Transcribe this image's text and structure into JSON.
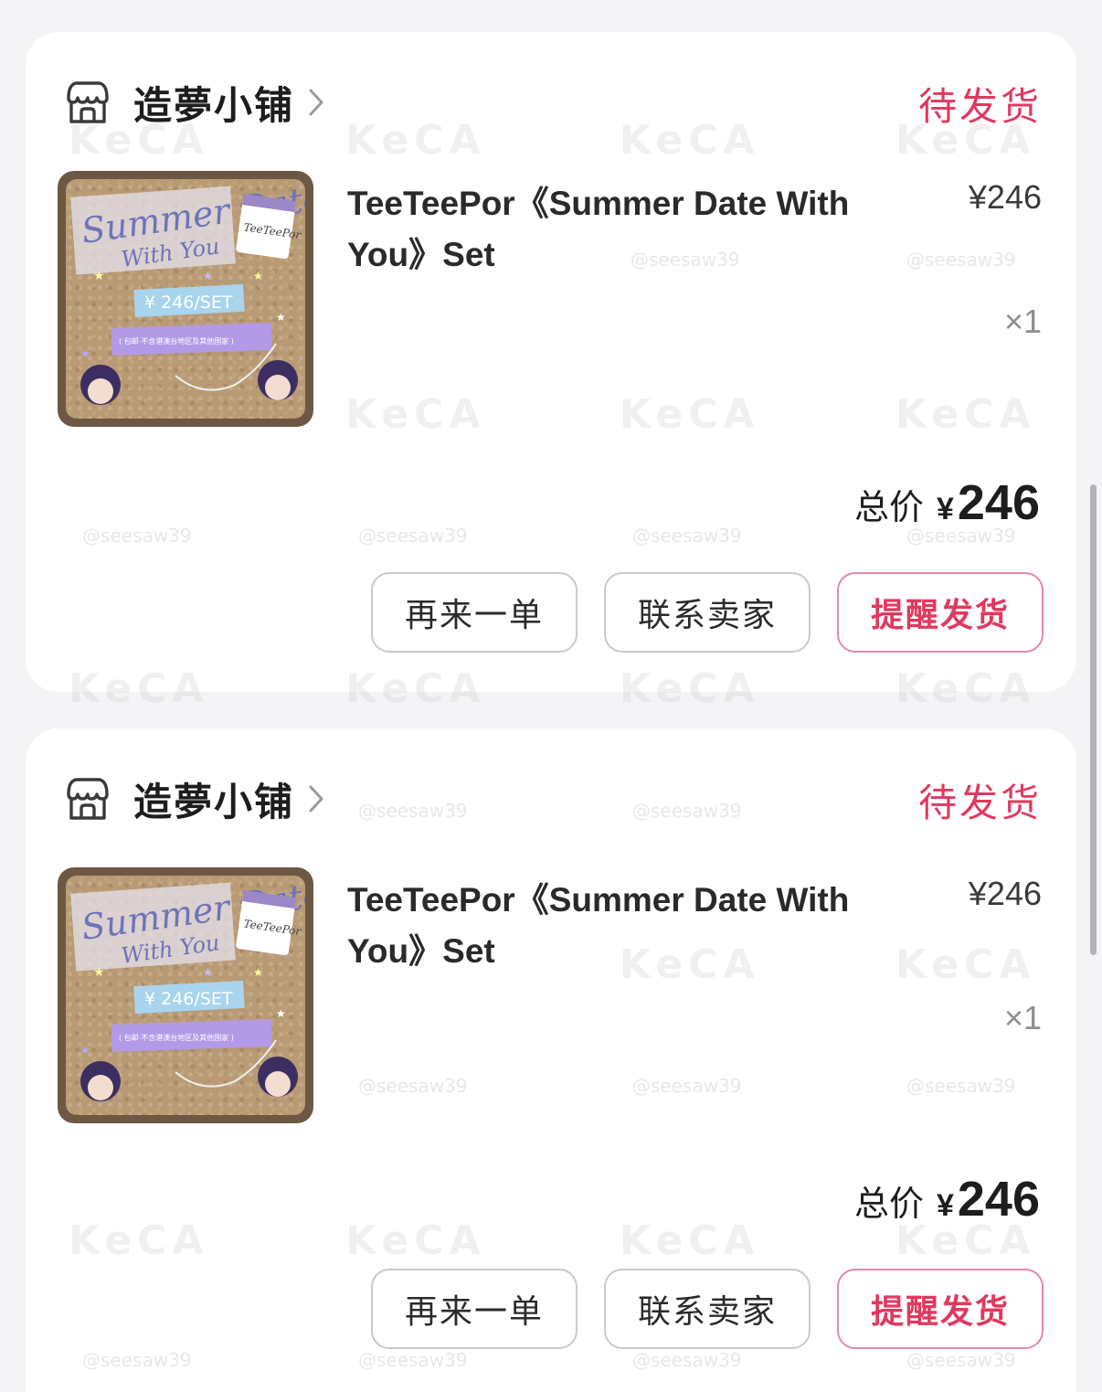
{
  "orders": [
    {
      "shop_name": "造夢小铺",
      "status": "待发货",
      "product_title": "TeeTeePor《Summer Date With You》Set",
      "unit_price": "¥246",
      "quantity": "×1",
      "total_label": "总价",
      "total_currency": "¥",
      "total_amount": "246",
      "actions": [
        "再来一单",
        "联系卖家",
        "提醒发货"
      ]
    },
    {
      "shop_name": "造夢小铺",
      "status": "待发货",
      "product_title": "TeeTeePor《Summer Date With You》Set",
      "unit_price": "¥246",
      "quantity": "×1",
      "total_label": "总价",
      "total_currency": "¥",
      "total_amount": "246",
      "actions": [
        "再来一单",
        "联系卖家",
        "提醒发货"
      ]
    }
  ],
  "thumbnail_text": {
    "headline_1": "Summer Date",
    "headline_2": "With You",
    "tag": "TeeTeePor",
    "price_tag": "¥ 246/SET",
    "note": "( 包邮·不含港澳台地区及其他国家 )"
  },
  "watermark": {
    "logo": "KeCA",
    "handle": "@seesaw39"
  },
  "colors": {
    "accent": "#e0395f",
    "accent_border": "#e58aa2",
    "background": "#f4f4f6",
    "card": "#ffffff"
  },
  "icons": {
    "shop": "store-icon",
    "chevron": "chevron-right-icon"
  }
}
